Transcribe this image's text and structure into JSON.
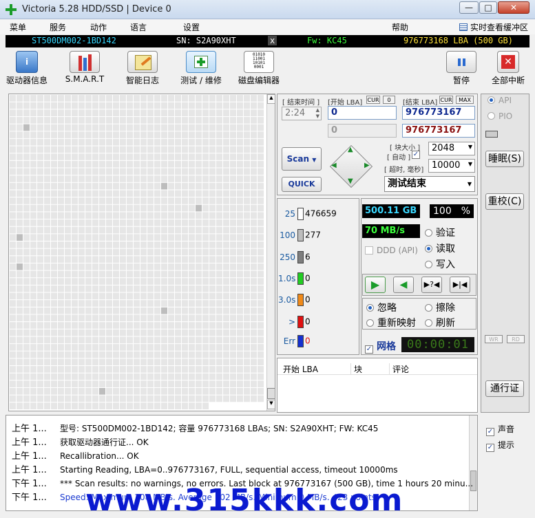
{
  "window": {
    "title": "Victoria 5.28 HDD/SSD | Device 0",
    "min": "—",
    "max": "□",
    "close": "✕"
  },
  "menu": {
    "items": [
      "菜单",
      "服务",
      "动作",
      "语言",
      "设置",
      "帮助"
    ],
    "buffer_view": "实时查看缓冲区"
  },
  "device": {
    "model": "ST500DM002-1BD142",
    "sn": "SN: S2A90XHT",
    "close": "x",
    "fw": "Fw: KC45",
    "lba": "976773168 LBA (500 GB)"
  },
  "toolbar": {
    "driver_info": "驱动器信息",
    "smart": "S.M.A.R.T",
    "smart_log": "智能日志",
    "test_repair": "测试 / 维修",
    "disk_editor": "磁盘编辑器",
    "pause": "暂停",
    "abort": "全部中断",
    "editor_bits": "01010\n11001\n10101\n0001"
  },
  "controls": {
    "end_time_label": "[ 结束时间 ]",
    "start_lba_label": "[开始 LBA]",
    "cur": "CUR",
    "zero": "0",
    "end_lba_label": "[结束 LBA]",
    "max": "MAX",
    "time": "2:24",
    "start_lba": "0",
    "end_lba": "976773167",
    "start_lba2": "0",
    "end_lba2": "976773167",
    "block_size_label": "[ 块大小 ]",
    "auto_label": "[ 自动 ]",
    "block_size": "2048",
    "timeout_label": "[ 超时, 毫秒]",
    "timeout": "10000",
    "scan": "Scan",
    "quick": "QUICK",
    "status": "测试结束"
  },
  "legend": {
    "rows": [
      {
        "label": "25",
        "count": "476659",
        "color": "#ffffff"
      },
      {
        "label": "100",
        "count": "277",
        "color": "#bdbdbd"
      },
      {
        "label": "250",
        "count": "6",
        "color": "#7e7e7e"
      },
      {
        "label": "1.0s",
        "count": "0",
        "color": "#22cc22"
      },
      {
        "label": "3.0s",
        "count": "0",
        "color": "#f08a1a"
      },
      {
        "label": ">",
        "count": "0",
        "color": "#e01010"
      },
      {
        "label": "Err",
        "count": "0",
        "color": "#1530d0"
      }
    ]
  },
  "stats": {
    "size": "500.11 GB",
    "percent": "100",
    "percent_sign": "%",
    "speed": "70 MB/s",
    "ddd": "DDD (API)"
  },
  "modes": {
    "verify": "验证",
    "read": "读取",
    "write": "写入"
  },
  "actions": {
    "ignore": "忽略",
    "erase": "擦除",
    "remap": "重新映射",
    "refresh": "刷新"
  },
  "grid": {
    "label": "网格",
    "timer": "00:00:01"
  },
  "table": {
    "headers": [
      "开始 LBA",
      "块",
      "评论"
    ]
  },
  "side": {
    "api": "API",
    "pio": "PIO",
    "sleep": "睡眠(S)",
    "recal": "重校(C)",
    "wr": "WR",
    "rd": "RD",
    "passport": "通行证",
    "sound": "声音",
    "hints": "提示"
  },
  "log": [
    {
      "time": "上午 1...",
      "msg": "型号: ST500DM002-1BD142; 容量 976773168 LBAs; SN: S2A90XHT; FW: KC45",
      "color": "#000000"
    },
    {
      "time": "上午 1...",
      "msg": "获取驱动器通行证... OK",
      "color": "#000000"
    },
    {
      "time": "上午 1...",
      "msg": "Recallibration... OK",
      "color": "#000000"
    },
    {
      "time": "上午 1...",
      "msg": "Starting Reading, LBA=0..976773167, FULL, sequential access, timeout 10000ms",
      "color": "#000000"
    },
    {
      "time": "下午 1...",
      "msg": "*** Scan results: no warnings, no errors. Last block at 976773167 (500 GB), time 1 hours 20 minu...",
      "color": "#000000"
    },
    {
      "time": "下午 1...",
      "msg": "Speed: Maximum 208 MB/s. Average 102 MB/s. Minimum 0 MB/s. 423 points",
      "color": "#1a3ad0"
    }
  ],
  "watermark": "www.315kkk.com"
}
